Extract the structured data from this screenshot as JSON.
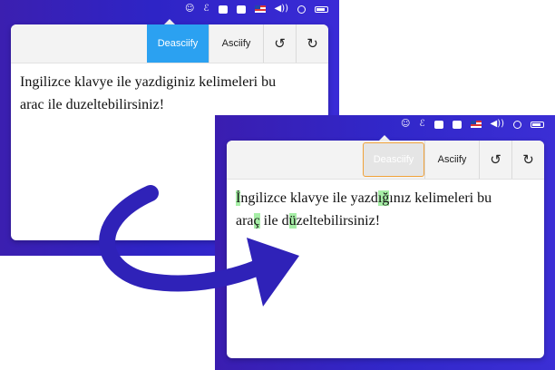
{
  "before": {
    "toolbar": {
      "deasciify": "Deasciify",
      "asciify": "Asciify"
    },
    "text_lines": [
      "Ingilizce klavye ile yazdiginiz kelimeleri bu",
      "arac ile duzeltebilirsiniz!"
    ]
  },
  "after": {
    "toolbar": {
      "deasciify": "Deasciify",
      "asciify": "Asciify"
    },
    "line1": [
      {
        "t": "İ",
        "h": true
      },
      {
        "t": "ngilizce klavye ile yazd",
        "h": false
      },
      {
        "t": "ığ",
        "h": true
      },
      {
        "t": "ı",
        "h": false
      },
      {
        "t": "nız kelimeleri bu",
        "h": false
      }
    ],
    "line2": [
      {
        "t": "ara",
        "h": false
      },
      {
        "t": "ç",
        "h": true
      },
      {
        "t": " ile d",
        "h": false
      },
      {
        "t": "ü",
        "h": true
      },
      {
        "t": "zeltebilirsiniz!",
        "h": false
      }
    ]
  },
  "icons": {
    "undo": "↺",
    "redo": "↻",
    "volume": "◀))",
    "script": "ℰ"
  },
  "colors": {
    "background_gradient": [
      "#3b1fb0",
      "#3a2bd6"
    ],
    "active_button": "#2ba1f1",
    "highlight": "#a6eea6",
    "focus_ring": "#f0a23a",
    "arrow": "#2f22b8"
  }
}
